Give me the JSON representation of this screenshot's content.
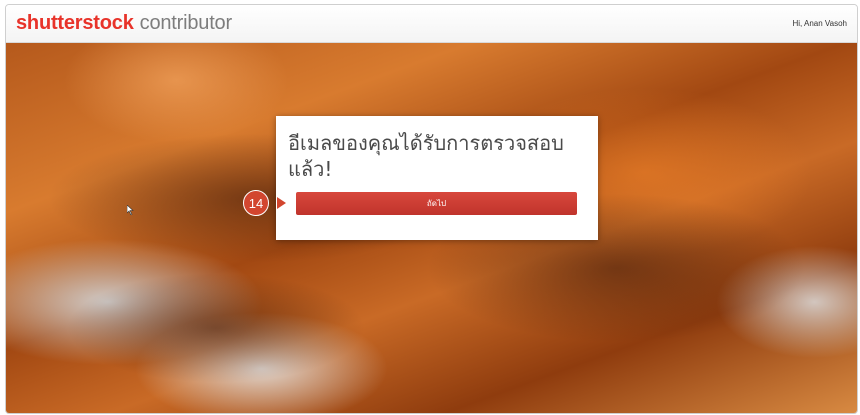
{
  "header": {
    "brand_main": "shutterstock",
    "brand_sub": "contributor",
    "greeting": "Hi, Anan Vasoh"
  },
  "modal": {
    "message": "อีเมลของคุณได้รับการตรวจสอบแล้ว!",
    "next_label": "ถัดไป"
  },
  "annotation": {
    "step_number": "14"
  },
  "colors": {
    "brand_red": "#e8332a",
    "button_red": "#c8392f",
    "marker_red": "#d2462f"
  }
}
